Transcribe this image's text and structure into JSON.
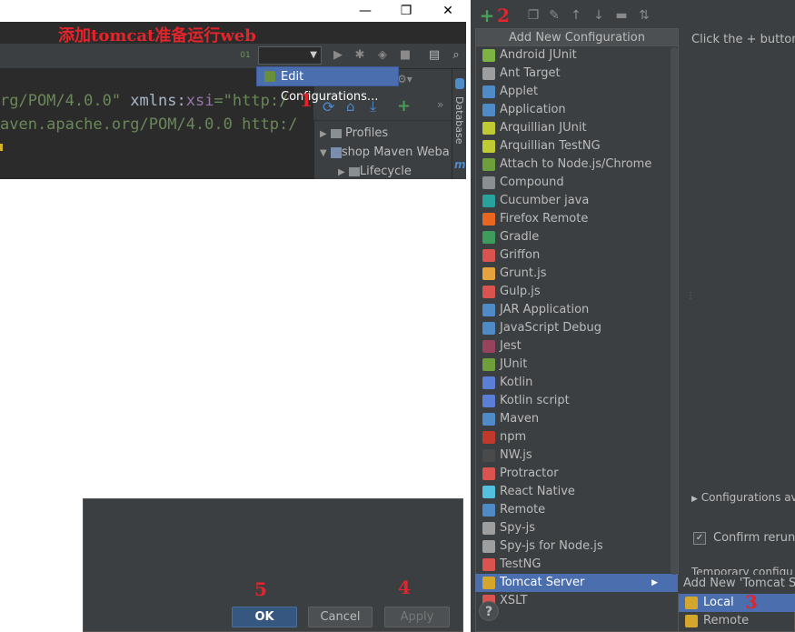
{
  "annotation": {
    "title": "添加tomcat准备运行web",
    "step1": "1",
    "step2": "2",
    "step3": "3",
    "step4": "4",
    "step5": "5"
  },
  "window_controls": {
    "minimize": "—",
    "restore": "❐",
    "close": "✕"
  },
  "editor": {
    "lines": [
      {
        "parts": [
          "rg/POM/4.0.0\"",
          " xmlns:",
          "xsi",
          "=\"http:/"
        ]
      },
      {
        "parts": [
          "aven.apache.org/POM/4.0.0 http:/"
        ]
      }
    ]
  },
  "run_popup": {
    "edit_configurations": "Edit Configurations..."
  },
  "maven_panel": {
    "side_label": "Database",
    "items": [
      {
        "label": "Profiles"
      },
      {
        "label": "shop Maven Weba"
      },
      {
        "label": "Lifecycle"
      }
    ]
  },
  "add_config_menu": {
    "header": "Add New Configuration",
    "items": [
      {
        "label": "Android JUnit",
        "color": "#7cb342"
      },
      {
        "label": "Ant Target",
        "color": "#9e9e9e"
      },
      {
        "label": "Applet",
        "color": "#4f8ac9"
      },
      {
        "label": "Application",
        "color": "#4f8ac9"
      },
      {
        "label": "Arquillian JUnit",
        "color": "#c0ca33"
      },
      {
        "label": "Arquillian TestNG",
        "color": "#c0ca33"
      },
      {
        "label": "Attach to Node.js/Chrome",
        "color": "#6d9f3a"
      },
      {
        "label": "Compound",
        "color": "#8a8f92"
      },
      {
        "label": "Cucumber java",
        "color": "#29a19c"
      },
      {
        "label": "Firefox Remote",
        "color": "#e8661f"
      },
      {
        "label": "Gradle",
        "color": "#3d9b5b"
      },
      {
        "label": "Griffon",
        "color": "#d9534f"
      },
      {
        "label": "Grunt.js",
        "color": "#e6a23c"
      },
      {
        "label": "Gulp.js",
        "color": "#d9534f"
      },
      {
        "label": "JAR Application",
        "color": "#4f8ac9"
      },
      {
        "label": "JavaScript Debug",
        "color": "#4f8ac9"
      },
      {
        "label": "Jest",
        "color": "#99425b"
      },
      {
        "label": "JUnit",
        "color": "#6d9f3a"
      },
      {
        "label": "Kotlin",
        "color": "#5b7fd6"
      },
      {
        "label": "Kotlin script",
        "color": "#5b7fd6"
      },
      {
        "label": "Maven",
        "color": "#4f8ac9"
      },
      {
        "label": "npm",
        "color": "#c0392b"
      },
      {
        "label": "NW.js",
        "color": "#4a4a4a"
      },
      {
        "label": "Protractor",
        "color": "#d9534f"
      },
      {
        "label": "React Native",
        "color": "#53c1de"
      },
      {
        "label": "Remote",
        "color": "#4f8ac9"
      },
      {
        "label": "Spy-js",
        "color": "#9e9e9e"
      },
      {
        "label": "Spy-js for Node.js",
        "color": "#9e9e9e"
      },
      {
        "label": "TestNG",
        "color": "#d9534f"
      },
      {
        "label": "Tomcat Server",
        "color": "#d4a72c",
        "submenu_arrow": "▶"
      },
      {
        "label": "XSLT",
        "color": "#d9534f"
      }
    ]
  },
  "right_panel": {
    "click_hint": "Click the + button",
    "configurations_available": "Configurations avai",
    "confirm_rerun": "Confirm rerun w",
    "confirm_check": "✓",
    "temporary_config": "Temporary configu"
  },
  "tomcat_submenu": {
    "header": "Add New 'Tomcat Se",
    "items": [
      {
        "label": "Local"
      },
      {
        "label": "Remote"
      }
    ]
  },
  "bottom_dialog": {
    "ok": "OK",
    "cancel": "Cancel",
    "apply": "Apply"
  },
  "help": "?"
}
